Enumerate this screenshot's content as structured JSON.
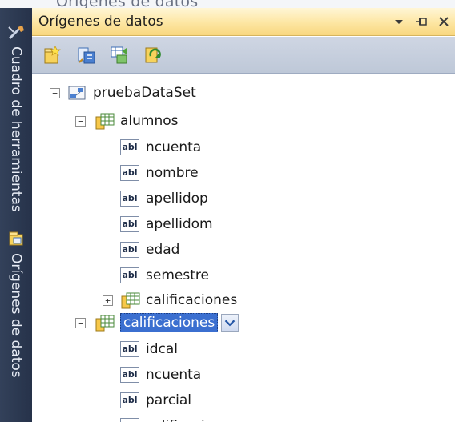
{
  "top_strip": {
    "ghost_text": "Orígenes de datos"
  },
  "side_tabs": [
    {
      "label": "Cuadro de herramientas"
    },
    {
      "label": "Orígenes de datos"
    }
  ],
  "panel": {
    "title": "Orígenes de datos",
    "title_icons": [
      "dropdown-arrow-icon",
      "pin-icon",
      "close-icon"
    ],
    "toolbar": [
      "add-new-data-source-icon",
      "edit-dataset-with-designer-icon",
      "configure-dataset-with-wizard-icon",
      "refresh-icon"
    ]
  },
  "tree": {
    "dataset": "pruebaDataSet",
    "tables": [
      {
        "name": "alumnos",
        "expanded": true,
        "fields": [
          "ncuenta",
          "nombre",
          "apellidop",
          "apellidom",
          "edad",
          "semestre"
        ],
        "children": [
          {
            "name": "calificaciones",
            "expanded": false
          }
        ]
      },
      {
        "name": "calificaciones",
        "expanded": true,
        "selected": true,
        "fields": [
          "idcal",
          "ncuenta",
          "parcial",
          "calificacion"
        ]
      }
    ]
  },
  "colors": {
    "title_bar": "#fde6a2",
    "toolbar": "#c6cfdd",
    "side_strip": "#2b3850",
    "selection": "#3b6fd0"
  }
}
